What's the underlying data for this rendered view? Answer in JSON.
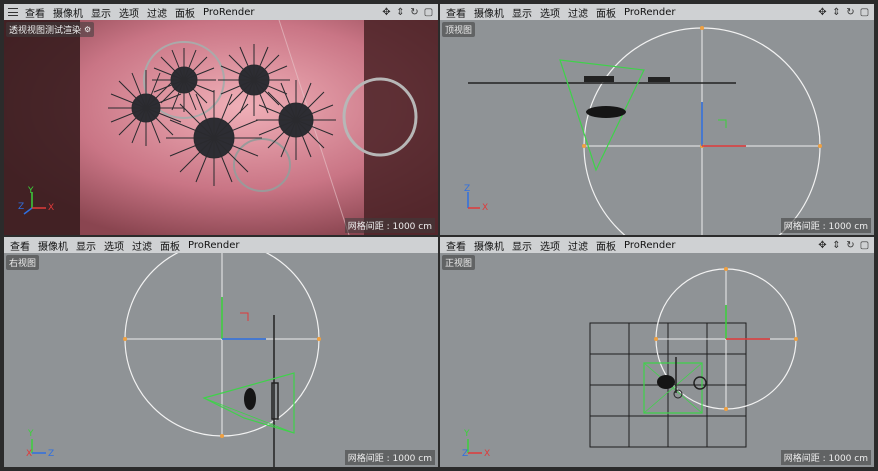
{
  "menu": [
    "查看",
    "摄像机",
    "显示",
    "选项",
    "过滤",
    "面板",
    "ProRender"
  ],
  "tools": [
    "move-view-icon",
    "zoom-view-icon",
    "rotate-view-icon",
    "maximize-view-icon"
  ],
  "viewports": {
    "perspective": {
      "label": "透视视图测试渲染",
      "grid": "网格间距 : 1000 cm"
    },
    "top": {
      "label": "顶视图",
      "grid": "网格间距 : 1000 cm"
    },
    "right": {
      "label": "右视图",
      "grid": "网格间距 : 1000 cm"
    },
    "front": {
      "label": "正视图",
      "grid": "网格间距 : 1000 cm"
    }
  },
  "axis_labels": {
    "x": "X",
    "y": "Y",
    "z": "Z"
  },
  "colors": {
    "viewport_bg": "#8f9396",
    "toolbar_bg": "#cfd1d3",
    "render_bg": "#c9808d",
    "camera_green": "#3fd24a",
    "light_orange": "#f0a040",
    "axis_red": "#e03a3a",
    "axis_blue": "#2f6fe0",
    "axis_green": "#3bd13b"
  }
}
